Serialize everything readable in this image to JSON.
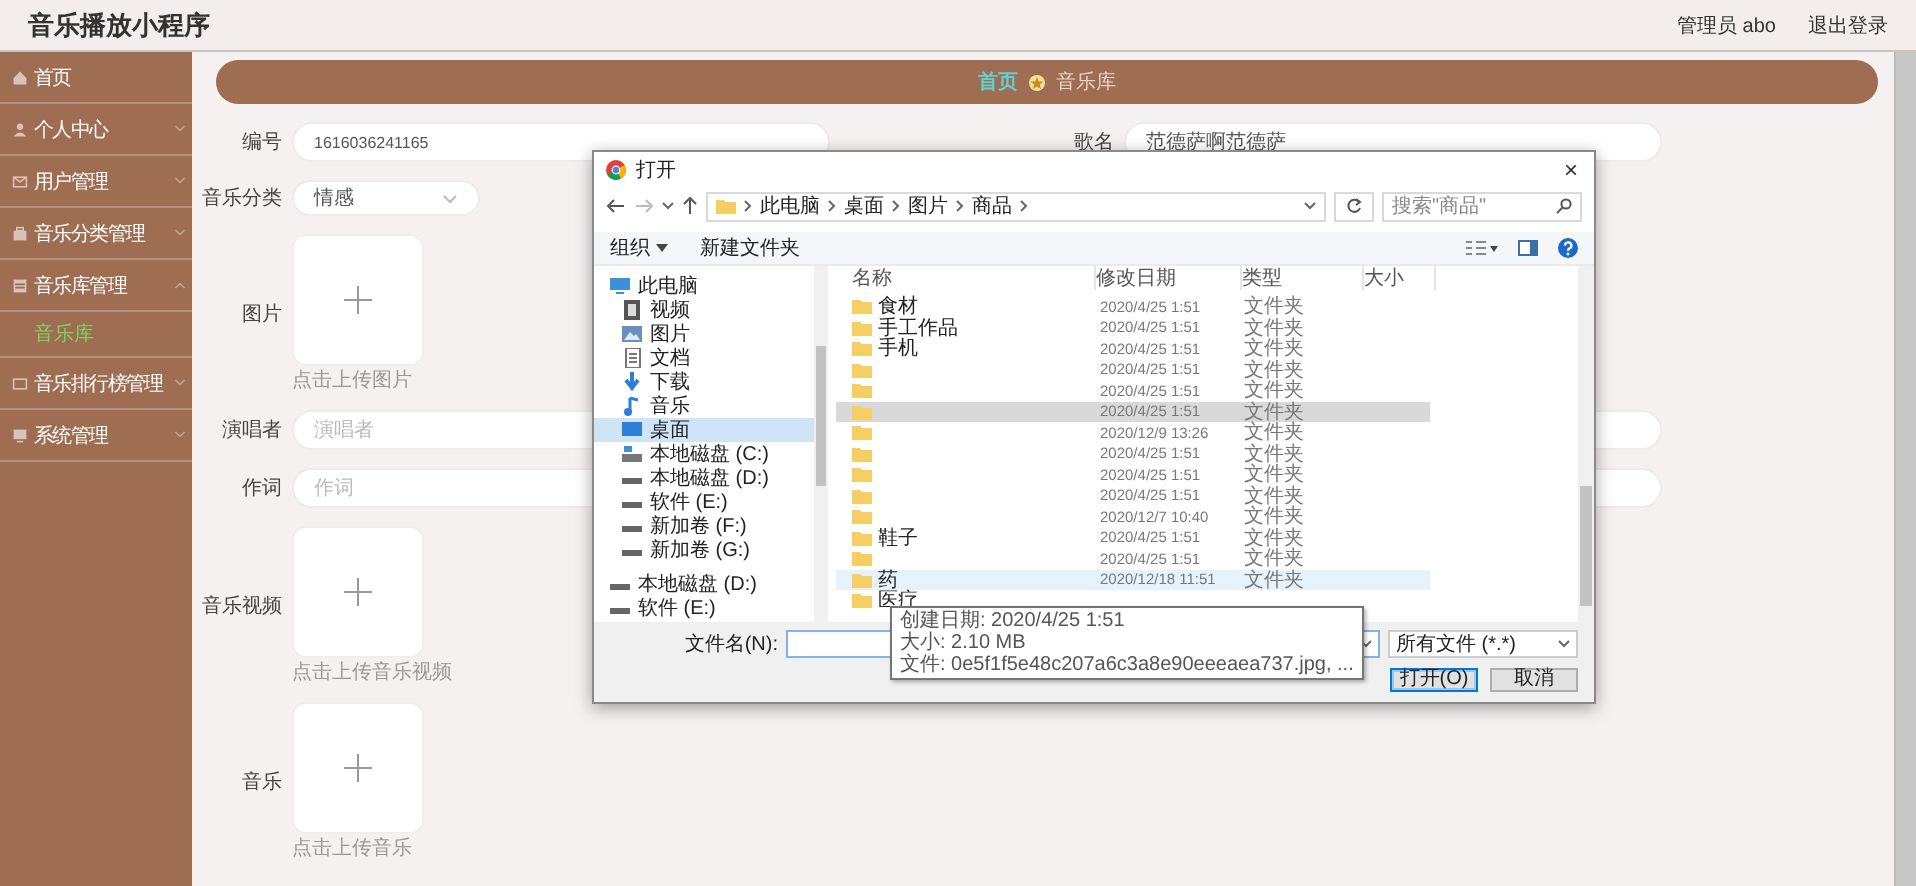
{
  "app": {
    "title": "音乐播放小程序",
    "user": "管理员 abo",
    "logout": "退出登录"
  },
  "sidebar": [
    {
      "label": "首页",
      "kind": "link"
    },
    {
      "label": "个人中心",
      "kind": "menu",
      "expanded": false
    },
    {
      "label": "用户管理",
      "kind": "menu",
      "expanded": false
    },
    {
      "label": "音乐分类管理",
      "kind": "menu",
      "expanded": false
    },
    {
      "label": "音乐库管理",
      "kind": "menu",
      "expanded": true,
      "children": [
        {
          "label": "音乐库",
          "selected": true
        }
      ]
    },
    {
      "label": "音乐排行榜管理",
      "kind": "menu",
      "expanded": false
    },
    {
      "label": "系统管理",
      "kind": "menu",
      "expanded": false
    }
  ],
  "breadcrumb": [
    {
      "label": "首页",
      "selected": false
    },
    {
      "label": "音乐库",
      "selected": true
    }
  ],
  "form": {
    "rows": [
      [
        {
          "kind": "input",
          "label": "编号",
          "value": "1616036241165"
        },
        {
          "kind": "input",
          "label": "歌名",
          "value": "范德萨啊范德萨"
        }
      ],
      [
        {
          "kind": "select",
          "label": "音乐分类",
          "value": "情感"
        }
      ],
      [
        {
          "kind": "upload",
          "label": "图片",
          "hint": "点击上传图片"
        }
      ],
      [
        {
          "kind": "input",
          "label": "演唱者",
          "placeholder": "演唱者"
        }
      ],
      [
        {
          "kind": "input",
          "label": "作词",
          "placeholder": "作词"
        }
      ],
      [
        {
          "kind": "upload",
          "label": "音乐视频",
          "hint": "点击上传音乐视频"
        }
      ],
      [
        {
          "kind": "upload",
          "label": "音乐",
          "hint": "点击上传音乐"
        }
      ]
    ]
  },
  "dialog": {
    "title": "打开",
    "close": "×",
    "path": [
      "此电脑",
      "桌面",
      "图片",
      "商品"
    ],
    "search": {
      "placeholder": "搜索\"商品\""
    },
    "toolbar": [
      {
        "label": "组织",
        "kind": "menu"
      },
      {
        "label": "新建文件夹",
        "kind": "button"
      }
    ],
    "nav": [
      {
        "label": "此电脑",
        "selected": false,
        "children": [
          {
            "label": "视频",
            "selected": false
          },
          {
            "label": "图片",
            "selected": false
          },
          {
            "label": "文档",
            "selected": false
          },
          {
            "label": "下载",
            "selected": false
          },
          {
            "label": "音乐",
            "selected": false
          },
          {
            "label": "桌面",
            "selected": true
          },
          {
            "label": "本地磁盘 (C:)",
            "selected": false
          },
          {
            "label": "本地磁盘 (D:)",
            "selected": false
          },
          {
            "label": "软件 (E:)",
            "selected": false
          },
          {
            "label": "新加卷 (F:)",
            "selected": false
          },
          {
            "label": "新加卷 (G:)",
            "selected": false
          }
        ]
      },
      {
        "label": "本地磁盘 (D:)",
        "selected": false
      },
      {
        "label": "软件 (E:)",
        "selected": false
      }
    ],
    "columns": [
      "名称",
      "修改日期",
      "类型",
      "大小"
    ],
    "files": [
      {
        "name": "食材",
        "date": "2020/4/25 1:51",
        "type": "文件夹",
        "selected": false,
        "hover": false
      },
      {
        "name": "手工作品",
        "date": "2020/4/25 1:51",
        "type": "文件夹",
        "selected": false,
        "hover": false
      },
      {
        "name": "手机",
        "date": "2020/4/25 1:51",
        "type": "文件夹",
        "selected": false,
        "hover": false
      },
      {
        "date": "2020/4/25 1:51",
        "type": "文件夹",
        "selected": false,
        "hover": false
      },
      {
        "date": "2020/4/25 1:51",
        "type": "文件夹",
        "selected": false,
        "hover": false
      },
      {
        "date": "2020/4/25 1:51",
        "type": "文件夹",
        "selected": true,
        "hover": false
      },
      {
        "date": "2020/12/9 13:26",
        "type": "文件夹",
        "selected": false,
        "hover": false
      },
      {
        "date": "2020/4/25 1:51",
        "type": "文件夹",
        "selected": false,
        "hover": false
      },
      {
        "date": "2020/4/25 1:51",
        "type": "文件夹",
        "selected": false,
        "hover": false
      },
      {
        "date": "2020/4/25 1:51",
        "type": "文件夹",
        "selected": false,
        "hover": false
      },
      {
        "date": "2020/12/7 10:40",
        "type": "文件夹",
        "selected": false,
        "hover": false
      },
      {
        "name": "鞋子",
        "date": "2020/4/25 1:51",
        "type": "文件夹",
        "selected": false,
        "hover": false
      },
      {
        "date": "2020/4/25 1:51",
        "type": "文件夹",
        "selected": false,
        "hover": false
      },
      {
        "name": "药",
        "date": "2020/12/18 11:51",
        "type": "文件夹",
        "selected": false,
        "hover": true
      },
      {
        "name": "医疗",
        "selected": false,
        "hover": false
      }
    ],
    "tooltip": [
      "创建日期: 2020/4/25 1:51",
      "大小: 2.10 MB",
      "文件: 0e5f1f5e48c207a6c3a8e90eeeaea737.jpg, ..."
    ],
    "filename": {
      "label": "文件名(N):"
    },
    "filter": "所有文件 (*.*)",
    "buttons": [
      {
        "label": "打开(O)",
        "default": true
      },
      {
        "label": "取消",
        "default": false
      }
    ]
  }
}
